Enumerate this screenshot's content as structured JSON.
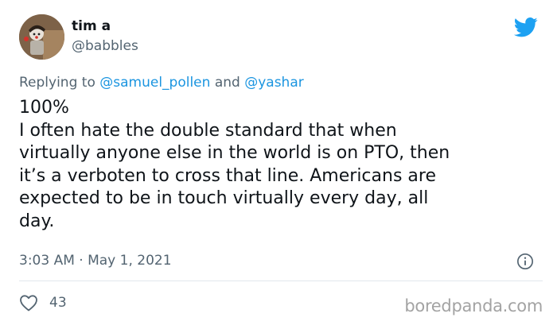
{
  "user": {
    "display_name": "tim a",
    "handle": "@babbles"
  },
  "reply": {
    "prefix": "Replying to",
    "mention_1": "@samuel_pollen",
    "joiner": "and",
    "mention_2": "@yashar"
  },
  "tweet": {
    "lines": [
      "100%",
      "I often hate the double standard that when",
      "virtually anyone else in the world is on PTO, then",
      "it’s a verboten to cross that line. Americans are",
      "expected to be in touch virtually every day, all",
      "day."
    ],
    "timestamp": "3:03 AM · May 1, 2021"
  },
  "actions": {
    "like_count": "43"
  },
  "watermark": "boredpanda.com",
  "colors": {
    "accent": "#1b95e0",
    "muted": "#536471",
    "divider": "#e1e8ed"
  },
  "icons": [
    "avatar",
    "twitter-bird-icon",
    "info-icon",
    "heart-icon"
  ]
}
